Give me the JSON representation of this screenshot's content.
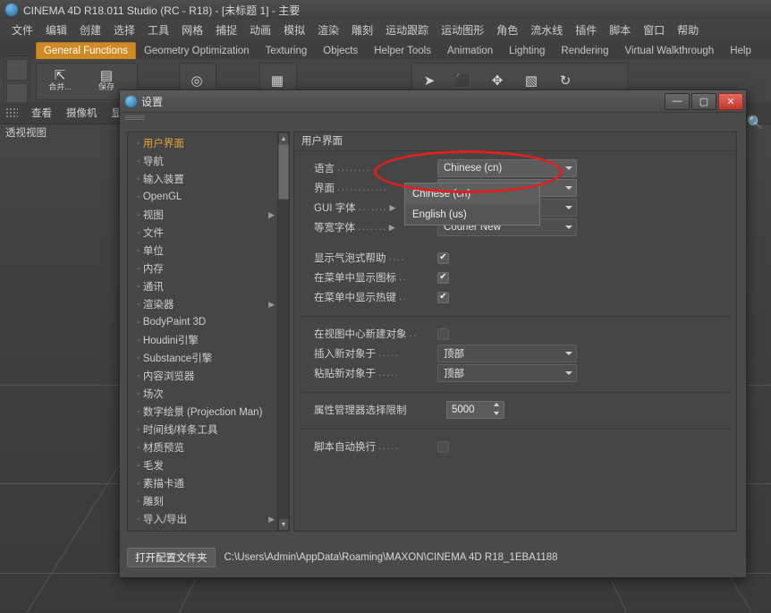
{
  "window": {
    "title": "CINEMA 4D R18.011 Studio (RC - R18) - [未标题 1] - 主要",
    "logo_icon": "c4d-logo-icon"
  },
  "menubar": {
    "items": [
      "文件",
      "编辑",
      "创建",
      "选择",
      "工具",
      "网格",
      "捕捉",
      "动画",
      "模拟",
      "渲染",
      "雕刻",
      "运动跟踪",
      "运动图形",
      "角色",
      "流水线",
      "插件",
      "脚本",
      "窗口",
      "帮助"
    ]
  },
  "tabs": {
    "items": [
      {
        "label": "General Functions",
        "active": true
      },
      {
        "label": "Geometry Optimization",
        "active": false
      },
      {
        "label": "Texturing",
        "active": false
      },
      {
        "label": "Objects",
        "active": false
      },
      {
        "label": "Helper Tools",
        "active": false
      },
      {
        "label": "Animation",
        "active": false
      },
      {
        "label": "Lighting",
        "active": false
      },
      {
        "label": "Rendering",
        "active": false
      },
      {
        "label": "Virtual Walkthrough",
        "active": false
      },
      {
        "label": "Help",
        "active": false
      }
    ]
  },
  "toolbar": {
    "buttons": [
      {
        "icon": "merge-icon",
        "label": "合并..."
      },
      {
        "icon": "save-icon",
        "label": "保存"
      },
      {
        "icon": "render-view-icon",
        "label": ""
      },
      {
        "icon": "render-region-icon",
        "label": ""
      },
      {
        "icon": "render-settings-icon",
        "label": ""
      },
      {
        "icon": "select-cursor-icon",
        "label": ""
      },
      {
        "icon": "box-object-icon",
        "label": ""
      },
      {
        "icon": "move-axis-icon",
        "label": ""
      },
      {
        "icon": "scale-icon",
        "label": ""
      },
      {
        "icon": "rotate-icon",
        "label": ""
      }
    ]
  },
  "secondrow": {
    "dots_icon": "grip-dots-icon",
    "items": [
      "查看",
      "摄像机",
      "显示"
    ]
  },
  "viewport": {
    "label": "透视视图",
    "magnifier_icon": "magnifier-icon"
  },
  "dialog": {
    "title": "设置",
    "icon": "c4d-logo-icon",
    "window_buttons": [
      {
        "name": "minimize-button",
        "glyph": "—"
      },
      {
        "name": "maximize-button",
        "glyph": "▢"
      },
      {
        "name": "close-button",
        "glyph": "✕"
      }
    ],
    "tree": {
      "items": [
        {
          "label": "用户界面",
          "selected": true,
          "arrow": false
        },
        {
          "label": "导航",
          "selected": false,
          "arrow": false
        },
        {
          "label": "输入装置",
          "selected": false,
          "arrow": false
        },
        {
          "label": "OpenGL",
          "selected": false,
          "arrow": false
        },
        {
          "label": "视图",
          "selected": false,
          "arrow": true
        },
        {
          "label": "文件",
          "selected": false,
          "arrow": false
        },
        {
          "label": "单位",
          "selected": false,
          "arrow": false
        },
        {
          "label": "内存",
          "selected": false,
          "arrow": false
        },
        {
          "label": "通讯",
          "selected": false,
          "arrow": false
        },
        {
          "label": "渲染器",
          "selected": false,
          "arrow": true
        },
        {
          "label": "BodyPaint 3D",
          "selected": false,
          "arrow": false
        },
        {
          "label": "Houdini引擎",
          "selected": false,
          "arrow": false
        },
        {
          "label": "Substance引擎",
          "selected": false,
          "arrow": false
        },
        {
          "label": "内容浏览器",
          "selected": false,
          "arrow": false
        },
        {
          "label": "场次",
          "selected": false,
          "arrow": false
        },
        {
          "label": "数字绘景 (Projection Man)",
          "selected": false,
          "arrow": false
        },
        {
          "label": "时间线/样条工具",
          "selected": false,
          "arrow": false
        },
        {
          "label": "材质预览",
          "selected": false,
          "arrow": false
        },
        {
          "label": "毛发",
          "selected": false,
          "arrow": false
        },
        {
          "label": "素描卡通",
          "selected": false,
          "arrow": false
        },
        {
          "label": "雕刻",
          "selected": false,
          "arrow": false
        },
        {
          "label": "导入/导出",
          "selected": false,
          "arrow": true
        }
      ]
    },
    "panel": {
      "header": "用户界面",
      "rows": [
        {
          "type": "combo",
          "label": "语言",
          "value": "Chinese (cn)",
          "arrow": false
        },
        {
          "type": "combo",
          "label": "界面",
          "value": "",
          "arrow": false
        },
        {
          "type": "combo",
          "label": "GUI 字体",
          "value": "",
          "arrow": true
        },
        {
          "type": "combo",
          "label": "等宽字体",
          "value": "Courier New",
          "arrow": true
        },
        {
          "type": "check",
          "label": "显示气泡式帮助",
          "checked": true
        },
        {
          "type": "check",
          "label": "在菜单中显示图标",
          "checked": true
        },
        {
          "type": "check",
          "label": "在菜单中显示热键",
          "checked": true
        },
        {
          "type": "check",
          "label": "在视图中心新建对象",
          "checked": false
        },
        {
          "type": "combo",
          "label": "插入新对象于",
          "value": "顶部",
          "arrow": false
        },
        {
          "type": "combo",
          "label": "粘贴新对象于",
          "value": "顶部",
          "arrow": false
        },
        {
          "type": "num",
          "label": "属性管理器选择限制",
          "value": "5000"
        },
        {
          "type": "check",
          "label": "脚本自动换行",
          "checked": false
        }
      ]
    },
    "dropdown": {
      "open": true,
      "options": [
        "Chinese (cn)",
        "English (us)"
      ],
      "highlighted": "Chinese (cn)"
    },
    "bottom": {
      "button": "打开配置文件夹",
      "path": "C:\\Users\\Admin\\AppData\\Roaming\\MAXON\\CINEMA 4D R18_1EBA1188"
    },
    "highlight": {
      "color": "#e02020",
      "target": "language-combo"
    }
  }
}
